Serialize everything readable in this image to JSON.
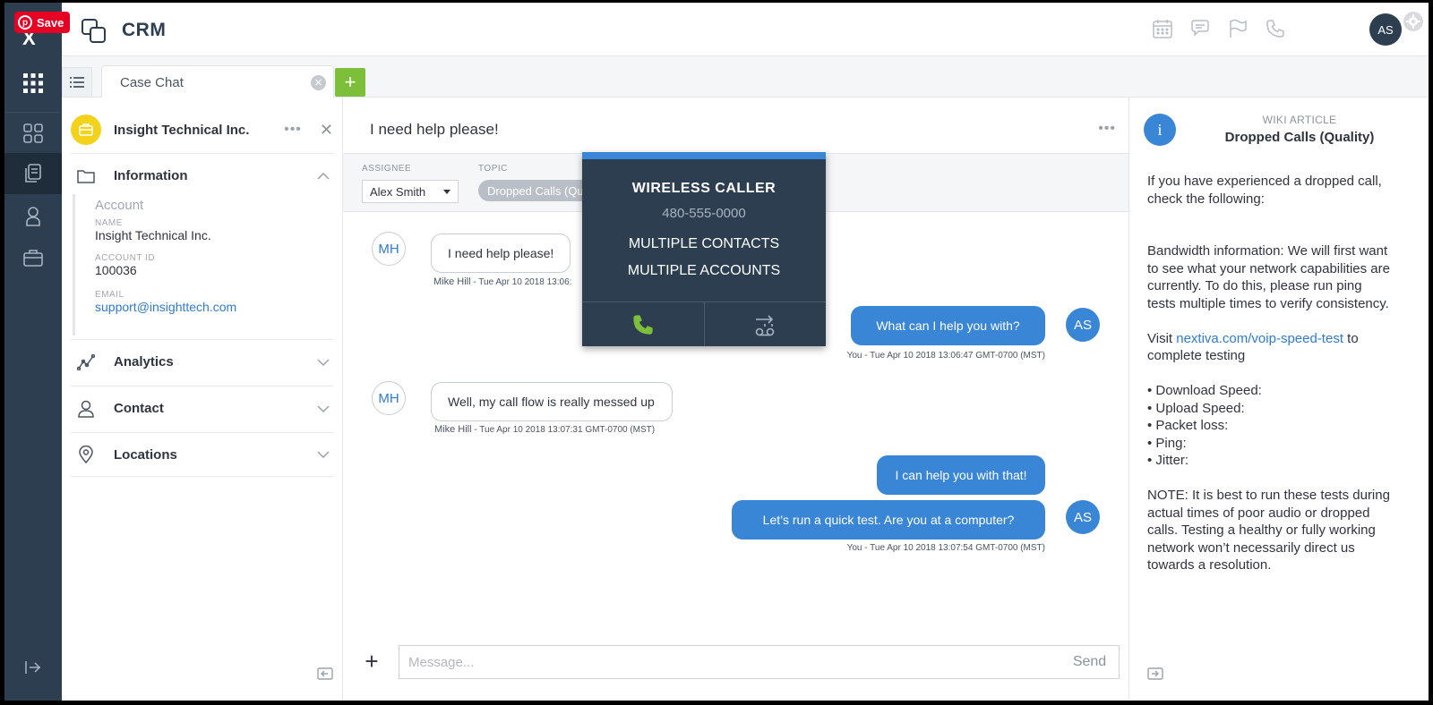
{
  "app": {
    "title": "CRM",
    "pinterest_save": "Save",
    "brand_mark": "X"
  },
  "topbar": {
    "avatar_initials": "AS"
  },
  "tabs": {
    "active_tab": "Case Chat"
  },
  "account": {
    "name": "Insight Technical Inc.",
    "sections": {
      "information": "Information",
      "analytics": "Analytics",
      "contact": "Contact",
      "locations": "Locations"
    },
    "info": {
      "heading": "Account",
      "name_label": "NAME",
      "name_value": "Insight Technical Inc.",
      "id_label": "ACCOUNT ID",
      "id_value": "100036",
      "email_label": "EMAIL",
      "email_value": "support@insighttech.com"
    }
  },
  "chat": {
    "title": "I need help please!",
    "assignee_label": "ASSIGNEE",
    "assignee_value": "Alex Smith",
    "topic_label": "TOPIC",
    "topic_value": "Dropped Calls (Quality)",
    "messages": [
      {
        "sender": "MH",
        "text": "I need help please!",
        "stamp_name": "Mike Hill",
        "stamp_time": " - Tue Apr 10 2018 13:06:"
      },
      {
        "sender": "AS",
        "text": "What can I help you with?",
        "stamp": "You - Tue Apr 10 2018 13:06:47 GMT-0700 (MST)"
      },
      {
        "sender": "MH",
        "text": "Well, my call flow is really messed up",
        "stamp_name": "Mike Hill",
        "stamp_time": " - Tue Apr 10 2018 13:07:31 GMT-0700 (MST)"
      },
      {
        "sender": "AS",
        "text": "I can help you with that!"
      },
      {
        "sender": "AS",
        "text": "Let’s run a quick test. Are you at a computer?",
        "stamp": "You - Tue Apr 10 2018 13:07:54 GMT-0700 (MST)"
      }
    ],
    "composer": {
      "placeholder": "Message...",
      "send_label": "Send"
    }
  },
  "call_popup": {
    "title": "WIRELESS CALLER",
    "number": "480-555-0000",
    "line1": "MULTIPLE CONTACTS",
    "line2": "MULTIPLE ACCOUNTS"
  },
  "wiki": {
    "badge": "i",
    "kicker": "WIKI ARTICLE",
    "title": "Dropped Calls (Quality)",
    "intro": "If you have experienced a dropped call, check the following:",
    "bandwidth": "Bandwidth information: We will first want to see what your network capabilities are currently. To do this, please run ping tests multiple times to verify consistency.",
    "visit_prefix": "Visit ",
    "visit_link": "nextiva.com/voip-speed-test",
    "visit_suffix": " to complete testing",
    "bullets": [
      "• Download Speed:",
      "• Upload Speed:",
      "• Packet loss:",
      "• Ping:",
      "• Jitter:"
    ],
    "note": "NOTE: It is best to run these tests during actual times of poor audio or dropped calls. Testing a healthy or fully working network won’t necessarily direct us towards a resolution."
  },
  "colors": {
    "rail": "#2c3e50",
    "accent": "#3a86d6",
    "add_green": "#7dbf3b",
    "badge_yellow": "#f3d21b",
    "pinterest": "#e60023"
  }
}
